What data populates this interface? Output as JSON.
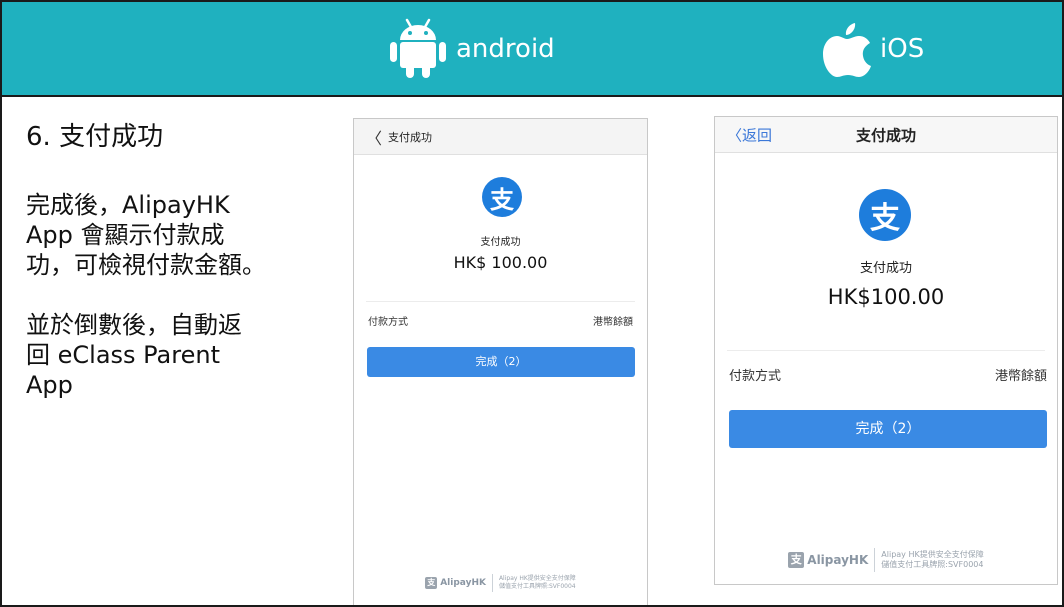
{
  "header": {
    "bg_color": "#1fb1bf",
    "android": {
      "label": "android",
      "icon": "android-icon"
    },
    "ios": {
      "label": "iOS",
      "icon": "apple-icon"
    }
  },
  "instructions": {
    "step_title": "6. 支付成功",
    "paragraph_1": "完成後，AlipayHK\nApp 會顯示付款成\n功，可檢視付款金額。",
    "paragraph_2": "並於倒數後，自動返\n回 eClass Parent\nApp"
  },
  "android_screen": {
    "nav": {
      "back_glyph": "〈",
      "title": "支付成功"
    },
    "logo_glyph": "支",
    "success_label": "支付成功",
    "amount": "HK$ 100.00",
    "payment_method_label": "付款方式",
    "payment_method_value": "港幣餘額",
    "done_button": "完成（2）",
    "footer": {
      "brand": "AlipayHK",
      "note_line_1": "Alipay HK提供安全支付保障",
      "note_line_2": "儲值支付工具牌照:SVF0004"
    }
  },
  "ios_screen": {
    "nav": {
      "back_label": "〈返回",
      "title": "支付成功"
    },
    "logo_glyph": "支",
    "success_label": "支付成功",
    "amount": "HK$100.00",
    "payment_method_label": "付款方式",
    "payment_method_value": "港幣餘額",
    "done_button": "完成（2）",
    "footer": {
      "brand": "AlipayHK",
      "note_line_1": "Alipay HK提供安全支付保障",
      "note_line_2": "儲值支付工具牌照:SVF0004"
    }
  },
  "colors": {
    "alipay_blue": "#1e7ddc",
    "button_blue": "#3a8ae4",
    "ios_link_blue": "#3c78d8"
  }
}
